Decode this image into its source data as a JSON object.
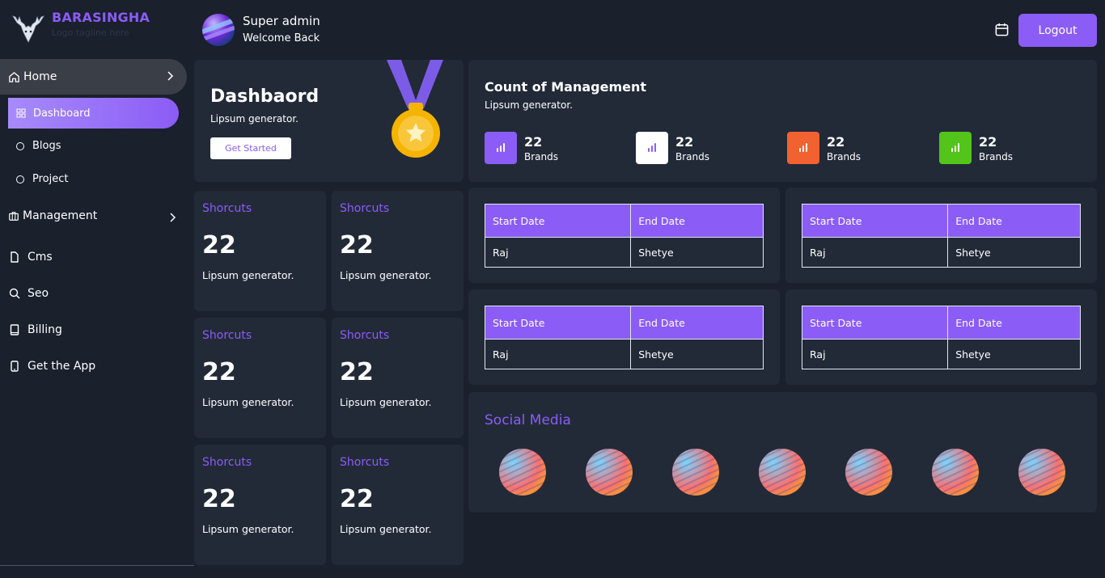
{
  "app": {
    "brand": "BARASINGHA",
    "tagline": "Logo tagline here"
  },
  "header": {
    "user_name": "Super admin",
    "greeting": "Welcome Back",
    "logout_label": "Logout"
  },
  "sidebar": {
    "home": "Home",
    "sub_items": [
      "Dashboard",
      "Blogs",
      "Project"
    ],
    "management": "Management",
    "items": [
      "Cms",
      "Seo",
      "Billing",
      "Get the App"
    ]
  },
  "welcome": {
    "title": "Dashbaord",
    "subtitle": "Lipsum generator.",
    "button": "Get Started"
  },
  "count": {
    "title": "Count of Management",
    "subtitle": "Lipsum generator.",
    "stats": [
      {
        "value": "22",
        "label": "Brands",
        "color": "#8b5cf6"
      },
      {
        "value": "22",
        "label": "Brands",
        "color": "#ffffff"
      },
      {
        "value": "22",
        "label": "Brands",
        "color": "#f26130"
      },
      {
        "value": "22",
        "label": "Brands",
        "color": "#52c41a"
      }
    ]
  },
  "shortcuts": [
    {
      "label": "Shorcuts",
      "value": "22",
      "desc": "Lipsum generator."
    },
    {
      "label": "Shorcuts",
      "value": "22",
      "desc": "Lipsum generator."
    },
    {
      "label": "Shorcuts",
      "value": "22",
      "desc": "Lipsum generator."
    },
    {
      "label": "Shorcuts",
      "value": "22",
      "desc": "Lipsum generator."
    },
    {
      "label": "Shorcuts",
      "value": "22",
      "desc": "Lipsum generator."
    },
    {
      "label": "Shorcuts",
      "value": "22",
      "desc": "Lipsum generator."
    }
  ],
  "tables": [
    {
      "headers": [
        "Start Date",
        "End Date"
      ],
      "rows": [
        [
          "Raj",
          "Shetye"
        ]
      ]
    },
    {
      "headers": [
        "Start Date",
        "End Date"
      ],
      "rows": [
        [
          "Raj",
          "Shetye"
        ]
      ]
    },
    {
      "headers": [
        "Start Date",
        "End Date"
      ],
      "rows": [
        [
          "Raj",
          "Shetye"
        ]
      ]
    },
    {
      "headers": [
        "Start Date",
        "End Date"
      ],
      "rows": [
        [
          "Raj",
          "Shetye"
        ]
      ]
    }
  ],
  "social": {
    "title": "Social Media",
    "count": 7
  }
}
